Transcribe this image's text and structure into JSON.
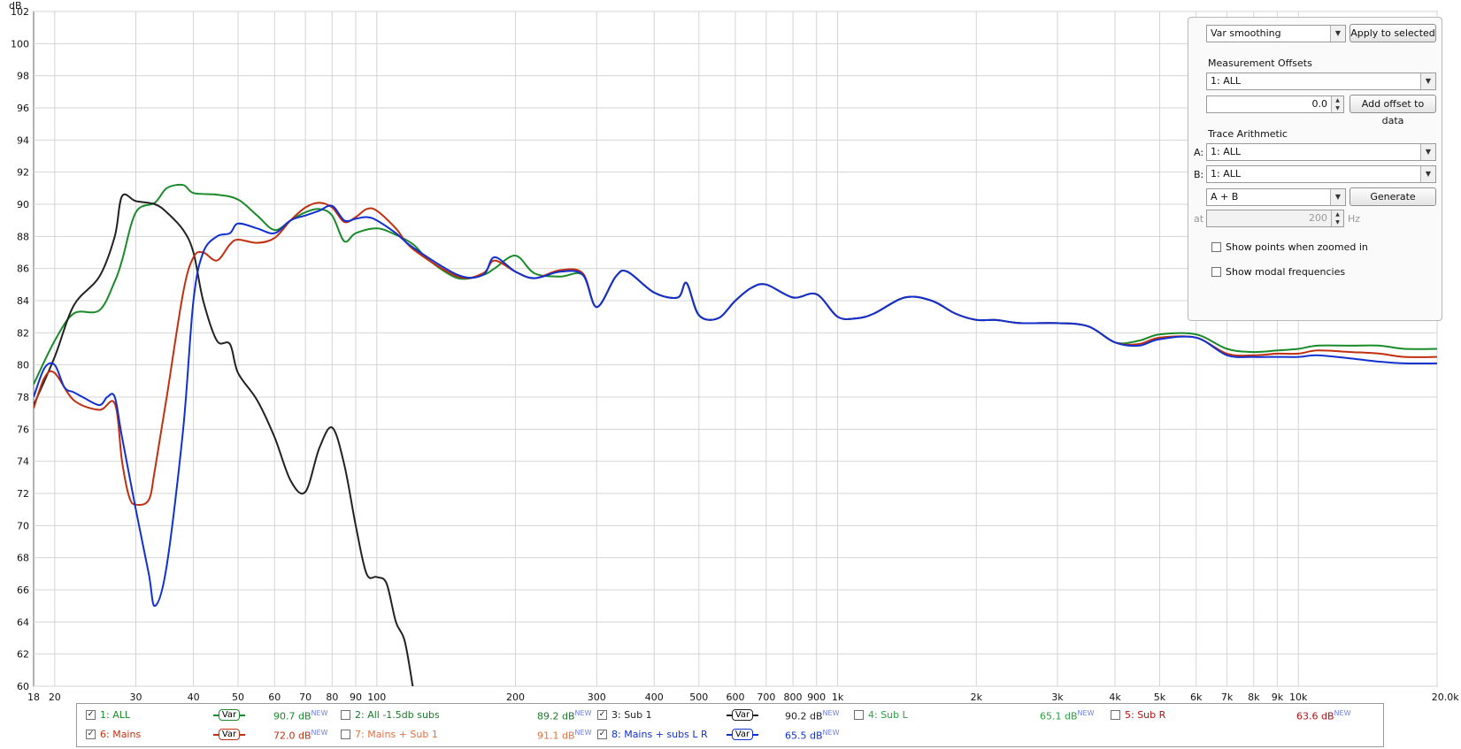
{
  "chart_data": {
    "type": "line",
    "ylabel": "dB",
    "xunit": "Hz",
    "xscale": "log",
    "xlim": [
      18,
      20000
    ],
    "ylim": [
      60,
      102
    ],
    "grid": true,
    "yticks": [
      "60",
      "62",
      "64",
      "66",
      "68",
      "70",
      "72",
      "74",
      "76",
      "78",
      "80",
      "82",
      "84",
      "86",
      "88",
      "90",
      "92",
      "94",
      "96",
      "98",
      "100",
      "102"
    ],
    "xticks": [
      {
        "v": 18,
        "t": "18"
      },
      {
        "v": 20,
        "t": "20"
      },
      {
        "v": 30,
        "t": "30"
      },
      {
        "v": 40,
        "t": "40"
      },
      {
        "v": 50,
        "t": "50"
      },
      {
        "v": 60,
        "t": "60"
      },
      {
        "v": 70,
        "t": "70"
      },
      {
        "v": 80,
        "t": "80"
      },
      {
        "v": 90,
        "t": "90"
      },
      {
        "v": 100,
        "t": "100"
      },
      {
        "v": 200,
        "t": "200"
      },
      {
        "v": 300,
        "t": "300"
      },
      {
        "v": 400,
        "t": "400"
      },
      {
        "v": 500,
        "t": "500"
      },
      {
        "v": 600,
        "t": "600"
      },
      {
        "v": 700,
        "t": "700"
      },
      {
        "v": 800,
        "t": "800"
      },
      {
        "v": 900,
        "t": "900"
      },
      {
        "v": 1000,
        "t": "1k"
      },
      {
        "v": 2000,
        "t": "2k"
      },
      {
        "v": 3000,
        "t": "3k"
      },
      {
        "v": 4000,
        "t": "4k"
      },
      {
        "v": 5000,
        "t": "5k"
      },
      {
        "v": 6000,
        "t": "6k"
      },
      {
        "v": 7000,
        "t": "7k"
      },
      {
        "v": 8000,
        "t": "8k"
      },
      {
        "v": 9000,
        "t": "9k"
      },
      {
        "v": 10000,
        "t": "10k"
      },
      {
        "v": 20000,
        "t": "20.0k Hz"
      }
    ],
    "series": [
      {
        "name": "1: ALL",
        "color": "#1a8a2a",
        "x": [
          18,
          20,
          22,
          25,
          27,
          28,
          30,
          33,
          35,
          38,
          40,
          45,
          50,
          55,
          60,
          65,
          70,
          75,
          80,
          85,
          90,
          100,
          110,
          120,
          130,
          150,
          170,
          180,
          200,
          220,
          250,
          280,
          300,
          330,
          350,
          400,
          450,
          470,
          500,
          550,
          600,
          650,
          700,
          800,
          900,
          1000,
          1100,
          1200,
          1400,
          1600,
          1800,
          2000,
          2200,
          2500,
          3000,
          3500,
          4000,
          4500,
          5000,
          6000,
          7000,
          8000,
          9000,
          10000,
          11000,
          13000,
          15000,
          17000,
          20000
        ],
        "y": [
          78.8,
          81.5,
          83.2,
          83.4,
          85.2,
          86.5,
          89.5,
          90.1,
          91.0,
          91.2,
          90.7,
          90.6,
          90.3,
          89.3,
          88.4,
          89.0,
          89.5,
          89.7,
          89.3,
          87.7,
          88.2,
          88.5,
          88.1,
          87.5,
          86.5,
          85.4,
          85.6,
          86.0,
          86.8,
          85.7,
          85.5,
          85.6,
          83.6,
          85.5,
          85.8,
          84.5,
          84.2,
          85.1,
          83.1,
          82.9,
          84.0,
          84.8,
          85.0,
          84.2,
          84.4,
          83.0,
          82.9,
          83.2,
          84.2,
          84.0,
          83.2,
          82.8,
          82.8,
          82.6,
          82.6,
          82.4,
          81.4,
          81.5,
          81.9,
          81.9,
          81.0,
          80.8,
          80.9,
          81.0,
          81.2,
          81.2,
          81.2,
          81.0,
          81.0
        ]
      },
      {
        "name": "3: Sub 1",
        "color": "#222222",
        "x": [
          18,
          20,
          22,
          25,
          27,
          28,
          30,
          33,
          35,
          38,
          40,
          42,
          45,
          48,
          50,
          55,
          60,
          65,
          70,
          75,
          80,
          85,
          90,
          95,
          100,
          105,
          110,
          115,
          120
        ],
        "y": [
          77.5,
          80.5,
          83.7,
          85.5,
          88.0,
          90.5,
          90.2,
          90.0,
          89.5,
          88.4,
          87.0,
          84.0,
          81.5,
          81.3,
          79.5,
          77.8,
          75.5,
          72.8,
          72.1,
          74.8,
          76.1,
          73.8,
          70.0,
          67.0,
          66.8,
          66.4,
          64.0,
          62.8,
          59.5
        ]
      },
      {
        "name": "6: Mains",
        "color": "#c03010",
        "x": [
          18,
          19,
          20,
          22,
          25,
          27,
          28,
          29,
          30,
          32,
          33,
          35,
          38,
          40,
          42,
          45,
          48,
          50,
          55,
          60,
          65,
          70,
          75,
          80,
          85,
          90,
          95,
          100,
          110,
          120,
          150,
          170,
          180,
          200,
          220,
          250,
          280,
          300,
          330,
          350,
          400,
          450,
          470,
          500,
          550,
          600,
          650,
          700,
          800,
          900,
          1000,
          1100,
          1200,
          1400,
          1600,
          1800,
          2000,
          2200,
          2500,
          3000,
          3500,
          4000,
          4500,
          5000,
          6000,
          7000,
          8000,
          9000,
          10000,
          11000,
          13000,
          15000,
          17000,
          20000
        ],
        "y": [
          77.3,
          79.2,
          79.5,
          77.8,
          77.2,
          77.6,
          74.0,
          71.8,
          71.3,
          71.6,
          73.5,
          78.0,
          84.5,
          86.7,
          87.0,
          86.5,
          87.5,
          87.8,
          87.6,
          87.9,
          89.0,
          89.8,
          90.1,
          89.8,
          88.9,
          89.2,
          89.7,
          89.6,
          88.5,
          87.2,
          85.5,
          85.7,
          86.5,
          85.8,
          85.4,
          85.9,
          85.7,
          83.6,
          85.5,
          85.8,
          84.5,
          84.2,
          85.1,
          83.1,
          82.9,
          84.0,
          84.8,
          85.0,
          84.2,
          84.4,
          83.0,
          82.9,
          83.2,
          84.2,
          84.0,
          83.2,
          82.8,
          82.8,
          82.6,
          82.6,
          82.4,
          81.4,
          81.3,
          81.7,
          81.7,
          80.7,
          80.6,
          80.7,
          80.7,
          80.9,
          80.8,
          80.7,
          80.5,
          80.5
        ]
      },
      {
        "name": "8: Mains + subs L R",
        "color": "#1030d0",
        "x": [
          18,
          19,
          20,
          21,
          22,
          23,
          25,
          26,
          27,
          28,
          30,
          32,
          33,
          35,
          38,
          40,
          42,
          45,
          48,
          50,
          55,
          60,
          65,
          70,
          75,
          80,
          85,
          90,
          95,
          100,
          110,
          120,
          150,
          170,
          180,
          200,
          220,
          250,
          280,
          300,
          330,
          350,
          400,
          450,
          470,
          500,
          550,
          600,
          650,
          700,
          800,
          900,
          1000,
          1100,
          1200,
          1400,
          1600,
          1800,
          2000,
          2200,
          2500,
          3000,
          3500,
          4000,
          4500,
          5000,
          6000,
          7000,
          8000,
          9000,
          10000,
          11000,
          13000,
          15000,
          17000,
          20000
        ],
        "y": [
          78.0,
          79.8,
          80.0,
          78.6,
          78.3,
          78.0,
          77.5,
          78.0,
          78.0,
          75.5,
          71.0,
          67.0,
          65.0,
          67.5,
          76.0,
          84.0,
          87.0,
          88.0,
          88.2,
          88.8,
          88.5,
          88.2,
          89.0,
          89.3,
          89.6,
          89.9,
          89.0,
          89.1,
          89.2,
          89.0,
          88.2,
          87.3,
          85.6,
          85.6,
          86.7,
          85.8,
          85.4,
          85.8,
          85.6,
          83.6,
          85.5,
          85.8,
          84.5,
          84.2,
          85.1,
          83.1,
          82.9,
          84.0,
          84.8,
          85.0,
          84.2,
          84.4,
          83.0,
          82.9,
          83.2,
          84.2,
          84.0,
          83.2,
          82.8,
          82.8,
          82.6,
          82.6,
          82.4,
          81.4,
          81.2,
          81.6,
          81.7,
          80.6,
          80.5,
          80.5,
          80.5,
          80.6,
          80.4,
          80.2,
          80.1,
          80.1
        ]
      }
    ]
  },
  "panel": {
    "smoothing_value": "Var smoothing",
    "apply_button": "Apply to selected",
    "offsets_title": "Measurement Offsets",
    "offset_measurement": "1: ALL",
    "offset_value": "0.0",
    "add_offset_button": "Add offset to data",
    "arith_title": "Trace Arithmetic",
    "a_label": "A:",
    "a_value": "1: ALL",
    "b_label": "B:",
    "b_value": "1: ALL",
    "op_value": "A + B",
    "generate_button": "Generate",
    "at_label": "at",
    "freq_value": "200",
    "hz_label": "Hz",
    "show_points_label": "Show points when zoomed in",
    "show_modal_label": "Show modal frequencies"
  },
  "legend": [
    {
      "name": "1: ALL",
      "checked": true,
      "color": "#1a8a2a",
      "level": "90.7 dB",
      "tag": "NEW",
      "var": "Var"
    },
    {
      "name": "2: All -1.5db subs",
      "checked": false,
      "color": "#1a7a2a",
      "level": "89.2 dB",
      "tag": "NEW"
    },
    {
      "name": "3: Sub 1",
      "checked": true,
      "color": "#222222",
      "level": "90.2 dB",
      "tag": "NEW",
      "var": "Var"
    },
    {
      "name": "4: Sub L",
      "checked": false,
      "color": "#2aa040",
      "level": "65.1 dB",
      "tag": "NEW"
    },
    {
      "name": "5: Sub R",
      "checked": false,
      "color": "#b01010",
      "level": "63.6 dB",
      "tag": "NEW"
    },
    {
      "name": "6: Mains",
      "checked": true,
      "color": "#c03010",
      "level": "72.0 dB",
      "tag": "NEW",
      "var": "Var"
    },
    {
      "name": "7: Mains + Sub 1",
      "checked": false,
      "color": "#e07040",
      "level": "91.1 dB",
      "tag": "NEW"
    },
    {
      "name": "8: Mains + subs L R",
      "checked": true,
      "color": "#1030d0",
      "level": "65.5 dB",
      "tag": "NEW",
      "var": "Var"
    }
  ]
}
